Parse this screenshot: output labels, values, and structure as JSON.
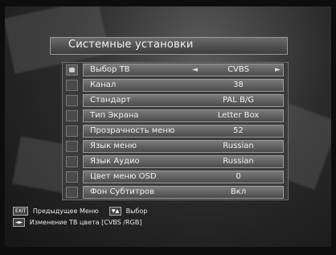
{
  "title": "Системные установки",
  "menu": [
    {
      "label": "Выбор ТВ",
      "value": "CVBS",
      "active": true
    },
    {
      "label": "Канал",
      "value": "38"
    },
    {
      "label": "Стандарт",
      "value": "PAL B/G"
    },
    {
      "label": "Тип Экрана",
      "value": "Letter Box"
    },
    {
      "label": "Прозрачность меню",
      "value": "52"
    },
    {
      "label": "Язык меню",
      "value": "Russian"
    },
    {
      "label": "Язык Аудио",
      "value": "Russian"
    },
    {
      "label": "Цвет меню OSD",
      "value": "0"
    },
    {
      "label": "Фон Субтитров",
      "value": "Вкл"
    }
  ],
  "help": {
    "line1_key1": "EXIT",
    "line1_text1": "Предыдущее Меню",
    "line1_key2": "▼▲",
    "line1_text2": "Выбор",
    "line2_key": "◄►",
    "line2_text": "Изменение ТВ цвета  [CVBS /RGB]"
  },
  "icons": {
    "left_arrow": "left-arrow-icon",
    "right_arrow": "right-arrow-icon"
  },
  "colors": {
    "panel": "#3a3a3a",
    "bar": "#6a6a6a",
    "text": "#f0f0f0"
  }
}
